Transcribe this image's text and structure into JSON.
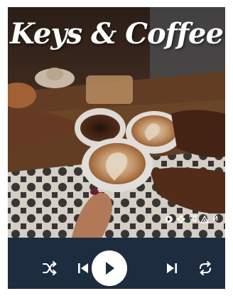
{
  "album": {
    "title": "Keys & Coffee",
    "label_logos": [
      "RW",
      "TM",
      "Й"
    ]
  },
  "controls": {
    "buttons": [
      {
        "name": "shuffle",
        "icon": "shuffle-icon"
      },
      {
        "name": "previous",
        "icon": "skip-previous-icon"
      },
      {
        "name": "play",
        "icon": "play-icon"
      },
      {
        "name": "next",
        "icon": "skip-next-icon"
      },
      {
        "name": "repeat",
        "icon": "repeat-icon"
      }
    ],
    "colors": {
      "bar_background": "#1d2c3e",
      "icon": "#ffffff",
      "play_button_fill": "#ffffff",
      "play_icon": "#1d2c3e"
    }
  }
}
